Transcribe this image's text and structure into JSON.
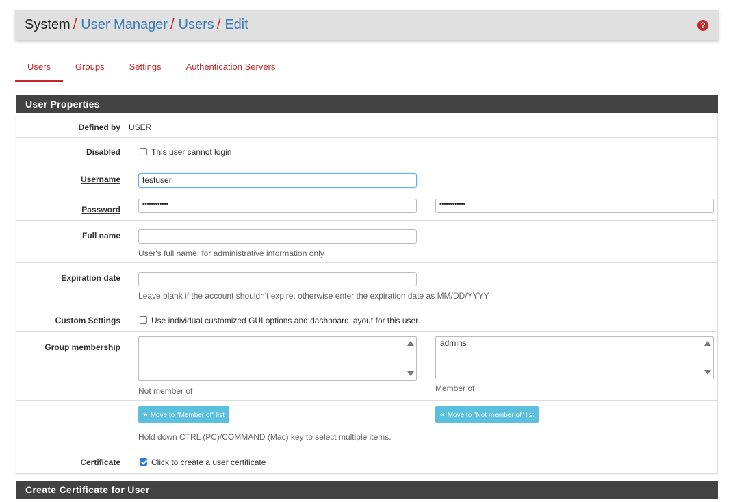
{
  "breadcrumb": {
    "root": "System",
    "sep": "/",
    "items": [
      "User Manager",
      "Users",
      "Edit"
    ]
  },
  "help_icon": "question-circle-icon",
  "tabs": [
    {
      "label": "Users",
      "active": true
    },
    {
      "label": "Groups",
      "active": false
    },
    {
      "label": "Settings",
      "active": false
    },
    {
      "label": "Authentication Servers",
      "active": false
    }
  ],
  "sections": {
    "user_properties": "User Properties",
    "create_cert": "Create Certificate for User"
  },
  "form": {
    "defined_by": {
      "label": "Defined by",
      "value": "USER"
    },
    "disabled": {
      "label": "Disabled",
      "checkbox_label": "This user cannot login",
      "checked": false
    },
    "username": {
      "label": "Username",
      "value": "testuser"
    },
    "password": {
      "label": "Password",
      "value": "••••••••••••",
      "confirm": "••••••••••••"
    },
    "full_name": {
      "label": "Full name",
      "value": "",
      "help": "User's full name, for administrative information only"
    },
    "expiration": {
      "label": "Expiration date",
      "value": "",
      "help": "Leave blank if the account shouldn't expire, otherwise enter the expiration date as MM/DD/YYYY"
    },
    "custom": {
      "label": "Custom Settings",
      "checkbox_label": "Use individual customized GUI options and dashboard layout for this user.",
      "checked": false
    },
    "groups": {
      "label": "Group membership",
      "not_member_caption": "Not member of",
      "member_caption": "Member of",
      "not_member_items": [],
      "member_items": [
        "admins"
      ],
      "move_to_member": "Move to \"Member of\" list",
      "move_to_not_member": "Move to \"Not member of\" list",
      "help": "Hold down CTRL (PC)/COMMAND (Mac) key to select multiple items."
    },
    "certificate": {
      "label": "Certificate",
      "checkbox_label": "Click to create a user certificate",
      "checked": true
    }
  },
  "colors": {
    "accent": "#c62828",
    "link": "#3c7ab5",
    "info_button": "#5bc0de",
    "panel_header": "#424242"
  }
}
